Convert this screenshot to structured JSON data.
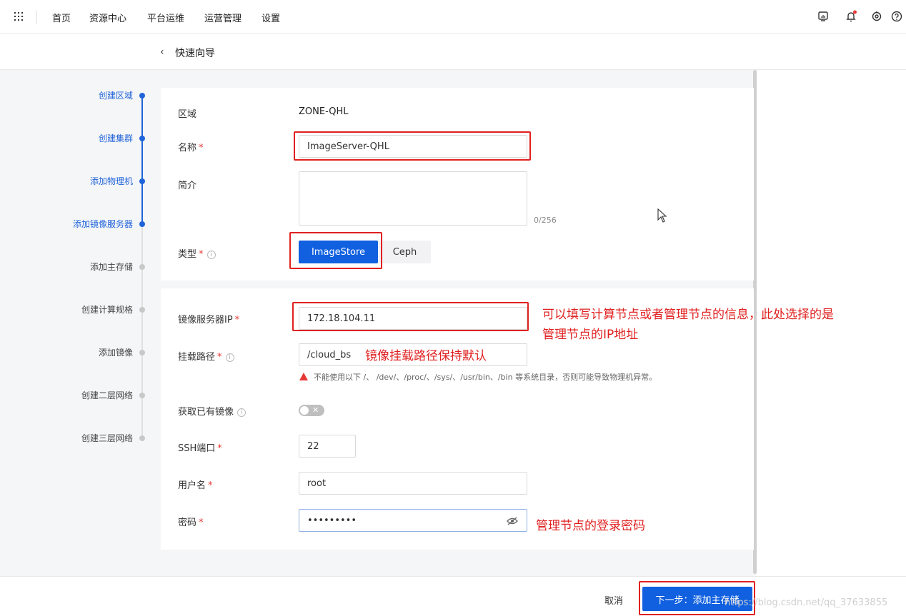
{
  "nav": {
    "items": [
      "首页",
      "资源中心",
      "平台运维",
      "运营管理",
      "设置"
    ]
  },
  "header": {
    "title": "快速向导"
  },
  "steps": [
    {
      "label": "创建区域",
      "active": true
    },
    {
      "label": "创建集群",
      "active": true
    },
    {
      "label": "添加物理机",
      "active": true
    },
    {
      "label": "添加镜像服务器",
      "active": true
    },
    {
      "label": "添加主存储",
      "active": false
    },
    {
      "label": "创建计算规格",
      "active": false
    },
    {
      "label": "添加镜像",
      "active": false
    },
    {
      "label": "创建二层网络",
      "active": false
    },
    {
      "label": "创建三层网络",
      "active": false
    }
  ],
  "form": {
    "zone_label": "区域",
    "zone_value": "ZONE-QHL",
    "name_label": "名称",
    "name_value": "ImageServer-QHL",
    "desc_label": "简介",
    "desc_counter": "0/256",
    "type_label": "类型",
    "type_options": [
      "ImageStore",
      "Ceph"
    ],
    "type_selected": "ImageStore",
    "ip_label": "镜像服务器IP",
    "ip_value": "172.18.104.11",
    "mount_label": "挂载路径",
    "mount_value": "/cloud_bs",
    "mount_warning": "不能使用以下 /、 /dev/、/proc/、/sys/、/usr/bin、/bin 等系统目录，否则可能导致物理机异常。",
    "import_label": "获取已有镜像",
    "import_enabled": false,
    "ssh_label": "SSH端口",
    "ssh_value": "22",
    "user_label": "用户名",
    "user_value": "root",
    "pwd_label": "密码",
    "pwd_value": "•••••••••"
  },
  "annotations": {
    "ip_note_1": "可以填写计算节点或者管理节点的信息，此处选择的是",
    "ip_note_2": "管理节点的IP地址",
    "mount_note": "镜像挂载路径保持默认",
    "pwd_note": "管理节点的登录密码"
  },
  "footer": {
    "cancel": "取消",
    "next": "下一步：添加主存储",
    "watermark": "https://blog.csdn.net/qq_37633855"
  },
  "colors": {
    "primary": "#1060e0",
    "annotation": "#e02020",
    "step_active": "#1f63d9"
  }
}
